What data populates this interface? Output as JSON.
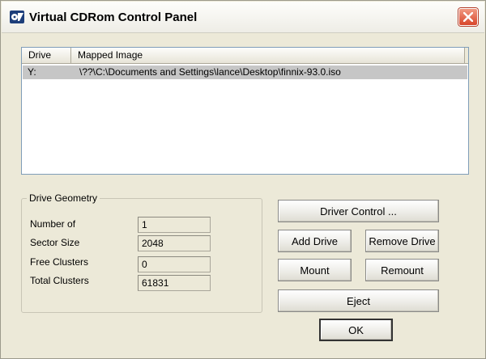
{
  "window": {
    "title": "Virtual CDRom Control Panel"
  },
  "list": {
    "columns": [
      "Drive",
      "Mapped Image"
    ],
    "rows": [
      {
        "drive": "Y:",
        "image": "\\??\\C:\\Documents and Settings\\lance\\Desktop\\finnix-93.0.iso"
      }
    ]
  },
  "geometry": {
    "legend": "Drive Geometry",
    "fields": [
      {
        "label": "Number of",
        "value": "1"
      },
      {
        "label": "Sector Size",
        "value": "2048"
      },
      {
        "label": "Free Clusters",
        "value": "0"
      },
      {
        "label": "Total Clusters",
        "value": "61831"
      }
    ]
  },
  "buttons": {
    "driver_control": "Driver Control ...",
    "add_drive": "Add Drive",
    "remove_drive": "Remove Drive",
    "mount": "Mount",
    "remount": "Remount",
    "eject": "Eject",
    "ok": "OK"
  },
  "icons": {
    "app": "cdrom-app-icon",
    "close": "close-icon"
  },
  "colors": {
    "close_button": "#d8452a",
    "selection": "#c6c6c6",
    "face": "#ece9d8"
  }
}
